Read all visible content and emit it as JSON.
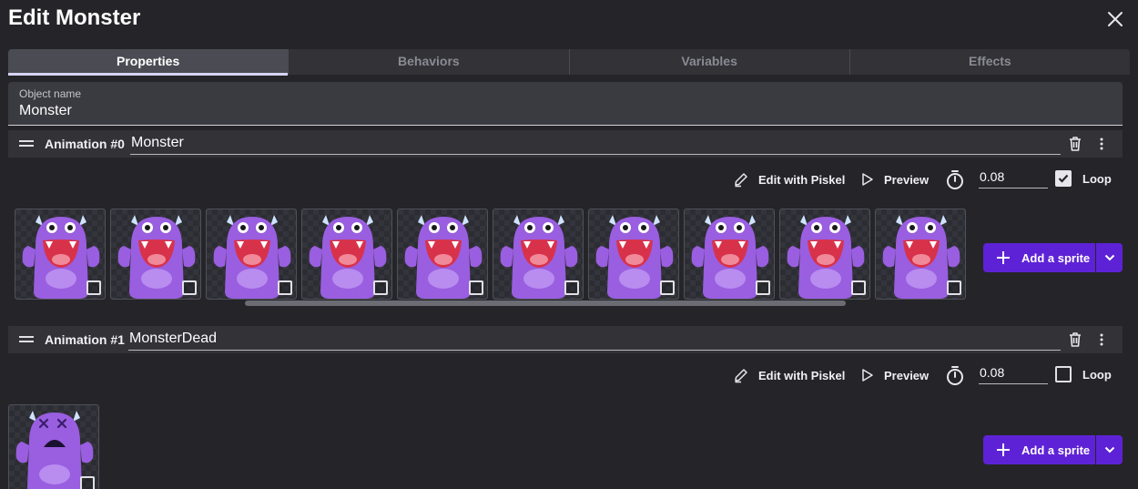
{
  "dialog": {
    "title": "Edit Monster",
    "close_icon": "close-icon"
  },
  "tabs": [
    {
      "label": "Properties",
      "active": true
    },
    {
      "label": "Behaviors",
      "active": false
    },
    {
      "label": "Variables",
      "active": false
    },
    {
      "label": "Effects",
      "active": false
    }
  ],
  "object_name": {
    "label": "Object name",
    "value": "Monster"
  },
  "animations": [
    {
      "label": "Animation #0",
      "name": "Monster",
      "edit_label": "Edit with Piskel",
      "preview_label": "Preview",
      "duration": "0.08",
      "loop_label": "Loop",
      "loop_checked": true,
      "sprite_count": 10,
      "add_sprite_label": "Add a sprite"
    },
    {
      "label": "Animation #1",
      "name": "MonsterDead",
      "edit_label": "Edit with Piskel",
      "preview_label": "Preview",
      "duration": "0.08",
      "loop_label": "Loop",
      "loop_checked": false,
      "sprite_count": 1,
      "add_sprite_label": "Add a sprite"
    }
  ],
  "colors": {
    "accent": "#5e22d6",
    "background": "#252529",
    "monster": "#9a5ee0",
    "mouth": "#d8324a"
  }
}
